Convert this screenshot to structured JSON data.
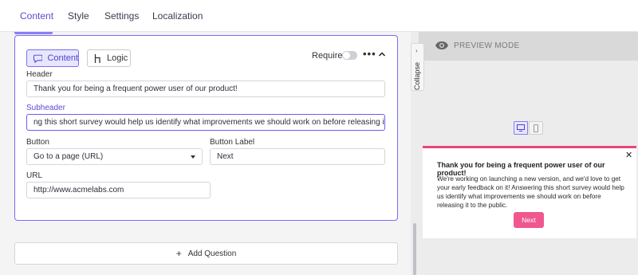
{
  "tabs": [
    {
      "label": "Content",
      "active": true
    },
    {
      "label": "Style",
      "active": false
    },
    {
      "label": "Settings",
      "active": false
    },
    {
      "label": "Localization",
      "active": false
    }
  ],
  "question": {
    "mode_buttons": {
      "content": "Content",
      "logic": "Logic"
    },
    "required_label": "Required",
    "required": false,
    "header": {
      "label": "Header",
      "value": "Thank you for being a frequent power user of our product!"
    },
    "subheader": {
      "label": "Subheader",
      "value": "ng this short survey would help us identify what improvements we should work on before releasing it to the public."
    },
    "button": {
      "label": "Button",
      "value": "Go to a page (URL)"
    },
    "button_label": {
      "label": "Button Label",
      "value": "Next"
    },
    "url": {
      "label": "URL",
      "value": "http://www.acmelabs.com"
    }
  },
  "add_question_label": "Add Question",
  "preview": {
    "mode_label": "PREVIEW MODE",
    "collapse_label": "Collapse",
    "device": "desktop",
    "survey": {
      "title": "Thank you for being a frequent power user of our product!",
      "body": "We're working on launching a new version, and we'd love to get your early feedback on it! Answering this short survey would help us identify what improvements we should work on before releasing it to the public.",
      "next_label": "Next"
    }
  },
  "colors": {
    "accent": "#5b4bd1",
    "survey_accent": "#e8457d",
    "next_button": "#f0578f"
  },
  "icons": [
    "chat-bubble-icon",
    "logic-icon",
    "more-options-icon",
    "chevron-up-icon",
    "chevron-down-icon",
    "plus-icon",
    "eye-icon",
    "chevron-right-icon",
    "desktop-icon",
    "mobile-icon",
    "close-icon"
  ]
}
